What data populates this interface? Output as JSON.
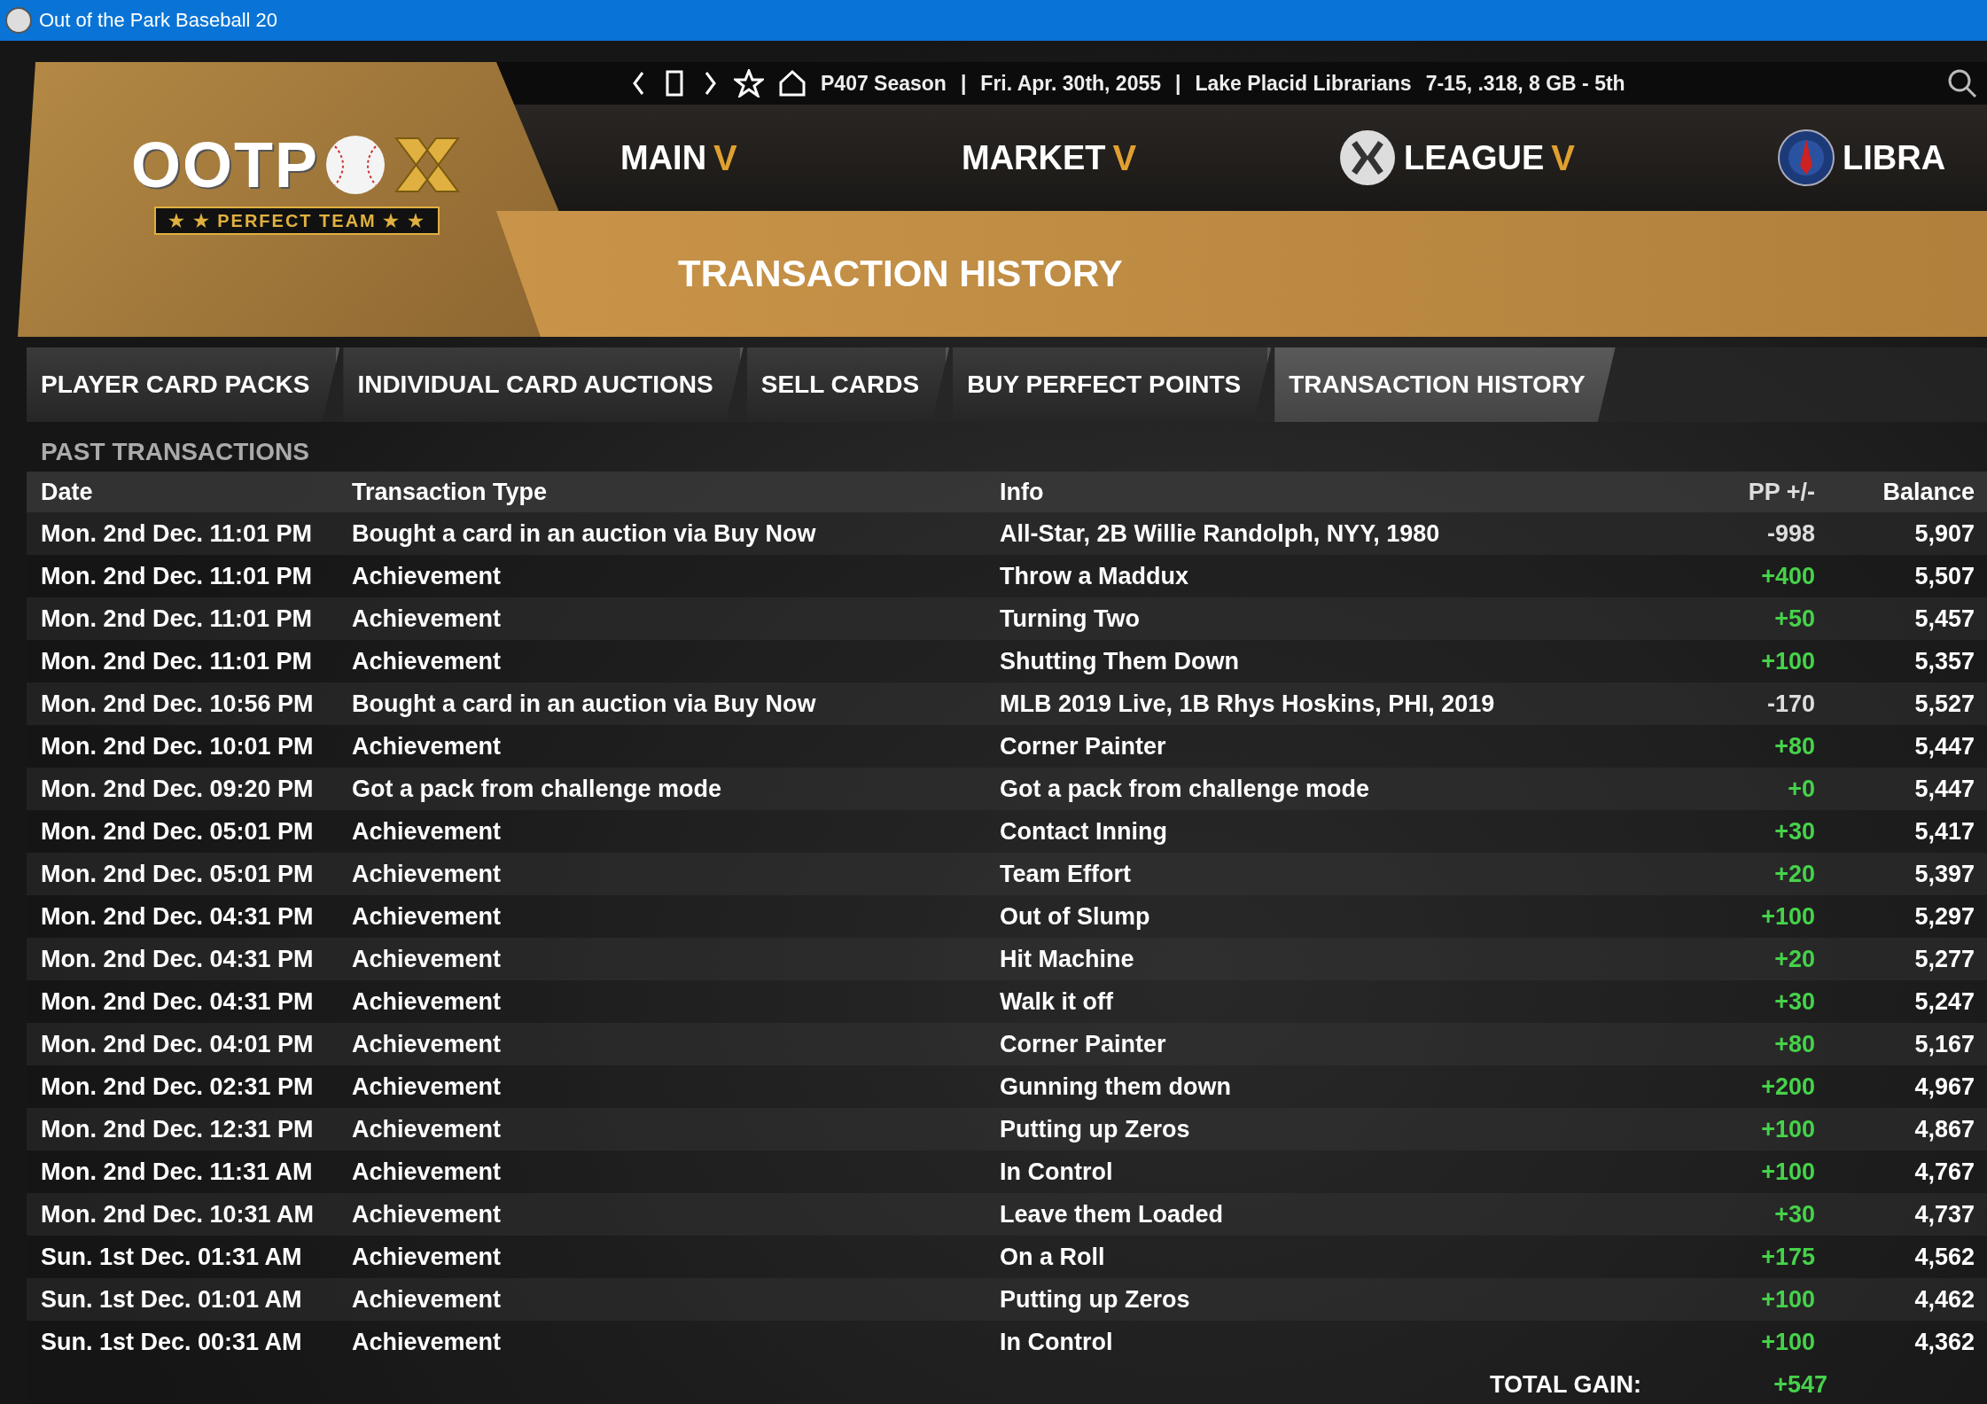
{
  "window": {
    "title": "Out of the Park Baseball 20"
  },
  "logo": {
    "wordmark": "OOTP",
    "tagline": "★ ★ PERFECT TEAM ★ ★"
  },
  "info_bar": {
    "season": "P407 Season",
    "separator_1": "|",
    "date": "Fri. Apr. 30th, 2055",
    "separator_2": "|",
    "team": "Lake Placid Librarians",
    "record": "7-15, .318, 8 GB - 5th"
  },
  "nav": [
    {
      "label": "MAIN",
      "caret": "V"
    },
    {
      "label": "MARKET",
      "caret": "V"
    },
    {
      "label": "LEAGUE",
      "caret": "V"
    },
    {
      "label": "LIBRA"
    }
  ],
  "page_title": "TRANSACTION HISTORY",
  "tabs": [
    {
      "label": "PLAYER CARD PACKS",
      "selected": false
    },
    {
      "label": "INDIVIDUAL CARD AUCTIONS",
      "selected": false
    },
    {
      "label": "SELL CARDS",
      "selected": false
    },
    {
      "label": "BUY PERFECT POINTS",
      "selected": false
    },
    {
      "label": "TRANSACTION HISTORY",
      "selected": true
    }
  ],
  "section_title": "PAST TRANSACTIONS",
  "table": {
    "columns": [
      "Date",
      "Transaction Type",
      "Info",
      "PP +/-",
      "Balance"
    ],
    "rows": [
      {
        "date": "Mon. 2nd Dec. 11:01 PM",
        "type": "Bought a card in an auction via Buy Now",
        "info": "All-Star, 2B Willie Randolph, NYY, 1980",
        "pp": "-998",
        "gain": false,
        "balance": "5,907"
      },
      {
        "date": "Mon. 2nd Dec. 11:01 PM",
        "type": "Achievement",
        "info": "Throw a Maddux",
        "pp": "+400",
        "gain": true,
        "balance": "5,507"
      },
      {
        "date": "Mon. 2nd Dec. 11:01 PM",
        "type": "Achievement",
        "info": "Turning Two",
        "pp": "+50",
        "gain": true,
        "balance": "5,457"
      },
      {
        "date": "Mon. 2nd Dec. 11:01 PM",
        "type": "Achievement",
        "info": "Shutting Them Down",
        "pp": "+100",
        "gain": true,
        "balance": "5,357"
      },
      {
        "date": "Mon. 2nd Dec. 10:56 PM",
        "type": "Bought a card in an auction via Buy Now",
        "info": "MLB 2019 Live, 1B Rhys Hoskins, PHI, 2019",
        "pp": "-170",
        "gain": false,
        "balance": "5,527"
      },
      {
        "date": "Mon. 2nd Dec. 10:01 PM",
        "type": "Achievement",
        "info": "Corner Painter",
        "pp": "+80",
        "gain": true,
        "balance": "5,447"
      },
      {
        "date": "Mon. 2nd Dec. 09:20 PM",
        "type": "Got a pack from challenge mode",
        "info": "Got a pack from challenge mode",
        "pp": "+0",
        "gain": true,
        "balance": "5,447"
      },
      {
        "date": "Mon. 2nd Dec. 05:01 PM",
        "type": "Achievement",
        "info": "Contact Inning",
        "pp": "+30",
        "gain": true,
        "balance": "5,417"
      },
      {
        "date": "Mon. 2nd Dec. 05:01 PM",
        "type": "Achievement",
        "info": "Team Effort",
        "pp": "+20",
        "gain": true,
        "balance": "5,397"
      },
      {
        "date": "Mon. 2nd Dec. 04:31 PM",
        "type": "Achievement",
        "info": "Out of Slump",
        "pp": "+100",
        "gain": true,
        "balance": "5,297"
      },
      {
        "date": "Mon. 2nd Dec. 04:31 PM",
        "type": "Achievement",
        "info": "Hit Machine",
        "pp": "+20",
        "gain": true,
        "balance": "5,277"
      },
      {
        "date": "Mon. 2nd Dec. 04:31 PM",
        "type": "Achievement",
        "info": "Walk it off",
        "pp": "+30",
        "gain": true,
        "balance": "5,247"
      },
      {
        "date": "Mon. 2nd Dec. 04:01 PM",
        "type": "Achievement",
        "info": "Corner Painter",
        "pp": "+80",
        "gain": true,
        "balance": "5,167"
      },
      {
        "date": "Mon. 2nd Dec. 02:31 PM",
        "type": "Achievement",
        "info": "Gunning them down",
        "pp": "+200",
        "gain": true,
        "balance": "4,967"
      },
      {
        "date": "Mon. 2nd Dec. 12:31 PM",
        "type": "Achievement",
        "info": "Putting up Zeros",
        "pp": "+100",
        "gain": true,
        "balance": "4,867"
      },
      {
        "date": "Mon. 2nd Dec. 11:31 AM",
        "type": "Achievement",
        "info": "In Control",
        "pp": "+100",
        "gain": true,
        "balance": "4,767"
      },
      {
        "date": "Mon. 2nd Dec. 10:31 AM",
        "type": "Achievement",
        "info": "Leave them Loaded",
        "pp": "+30",
        "gain": true,
        "balance": "4,737"
      },
      {
        "date": "Sun. 1st Dec. 01:31 AM",
        "type": "Achievement",
        "info": "On a Roll",
        "pp": "+175",
        "gain": true,
        "balance": "4,562"
      },
      {
        "date": "Sun. 1st Dec. 01:01 AM",
        "type": "Achievement",
        "info": "Putting up Zeros",
        "pp": "+100",
        "gain": true,
        "balance": "4,462"
      },
      {
        "date": "Sun. 1st Dec. 00:31 AM",
        "type": "Achievement",
        "info": "In Control",
        "pp": "+100",
        "gain": true,
        "balance": "4,362"
      }
    ],
    "total": {
      "label": "TOTAL GAIN:",
      "value": "+547"
    }
  }
}
